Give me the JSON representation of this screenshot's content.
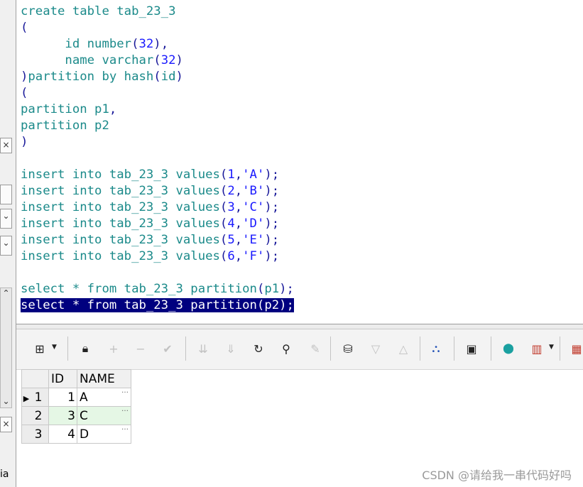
{
  "editor": {
    "lines": [
      [
        {
          "t": "create table tab_23_3",
          "c": "kw"
        }
      ],
      [
        {
          "t": "(",
          "c": "pn"
        }
      ],
      [
        {
          "t": "      id ",
          "c": "kw"
        },
        {
          "t": "number",
          "c": "kw"
        },
        {
          "t": "(",
          "c": "pn"
        },
        {
          "t": "32",
          "c": "nm"
        },
        {
          "t": "),",
          "c": "pn"
        }
      ],
      [
        {
          "t": "      name ",
          "c": "kw"
        },
        {
          "t": "varchar",
          "c": "kw"
        },
        {
          "t": "(",
          "c": "pn"
        },
        {
          "t": "32",
          "c": "nm"
        },
        {
          "t": ")",
          "c": "pn"
        }
      ],
      [
        {
          "t": ")",
          "c": "pn"
        },
        {
          "t": "partition by hash",
          "c": "kw"
        },
        {
          "t": "(",
          "c": "pn"
        },
        {
          "t": "id",
          "c": "kw"
        },
        {
          "t": ")",
          "c": "pn"
        }
      ],
      [
        {
          "t": "(",
          "c": "pn"
        }
      ],
      [
        {
          "t": "partition p1",
          "c": "kw"
        },
        {
          "t": ",",
          "c": "pn"
        }
      ],
      [
        {
          "t": "partition p2",
          "c": "kw"
        }
      ],
      [
        {
          "t": ")",
          "c": "pn"
        }
      ],
      [
        {
          "t": "",
          "c": "kw"
        }
      ],
      [
        {
          "t": "insert into tab_23_3 values",
          "c": "kw"
        },
        {
          "t": "(",
          "c": "pn"
        },
        {
          "t": "1",
          "c": "nm"
        },
        {
          "t": ",",
          "c": "pn"
        },
        {
          "t": "'A'",
          "c": "st"
        },
        {
          "t": ");",
          "c": "pn"
        }
      ],
      [
        {
          "t": "insert into tab_23_3 values",
          "c": "kw"
        },
        {
          "t": "(",
          "c": "pn"
        },
        {
          "t": "2",
          "c": "nm"
        },
        {
          "t": ",",
          "c": "pn"
        },
        {
          "t": "'B'",
          "c": "st"
        },
        {
          "t": ");",
          "c": "pn"
        }
      ],
      [
        {
          "t": "insert into tab_23_3 values",
          "c": "kw"
        },
        {
          "t": "(",
          "c": "pn"
        },
        {
          "t": "3",
          "c": "nm"
        },
        {
          "t": ",",
          "c": "pn"
        },
        {
          "t": "'C'",
          "c": "st"
        },
        {
          "t": ");",
          "c": "pn"
        }
      ],
      [
        {
          "t": "insert into tab_23_3 values",
          "c": "kw"
        },
        {
          "t": "(",
          "c": "pn"
        },
        {
          "t": "4",
          "c": "nm"
        },
        {
          "t": ",",
          "c": "pn"
        },
        {
          "t": "'D'",
          "c": "st"
        },
        {
          "t": ");",
          "c": "pn"
        }
      ],
      [
        {
          "t": "insert into tab_23_3 values",
          "c": "kw"
        },
        {
          "t": "(",
          "c": "pn"
        },
        {
          "t": "5",
          "c": "nm"
        },
        {
          "t": ",",
          "c": "pn"
        },
        {
          "t": "'E'",
          "c": "st"
        },
        {
          "t": ");",
          "c": "pn"
        }
      ],
      [
        {
          "t": "insert into tab_23_3 values",
          "c": "kw"
        },
        {
          "t": "(",
          "c": "pn"
        },
        {
          "t": "6",
          "c": "nm"
        },
        {
          "t": ",",
          "c": "pn"
        },
        {
          "t": "'F'",
          "c": "st"
        },
        {
          "t": ");",
          "c": "pn"
        }
      ],
      [
        {
          "t": "",
          "c": "kw"
        }
      ],
      [
        {
          "t": "select * from tab_23_3 partition",
          "c": "kw"
        },
        {
          "t": "(",
          "c": "pn"
        },
        {
          "t": "p1",
          "c": "kw"
        },
        {
          "t": ");",
          "c": "pn"
        }
      ],
      [
        {
          "t": "select * from tab_23_3 partition(p2);",
          "c": "hl"
        }
      ]
    ]
  },
  "toolbar": {
    "icons": [
      {
        "name": "grid-layout-icon",
        "glyph": "⊞",
        "enabled": true
      },
      {
        "name": "lock-icon",
        "glyph": "🔒︎",
        "enabled": true
      },
      {
        "name": "add-record-icon",
        "glyph": "+",
        "enabled": false
      },
      {
        "name": "delete-record-icon",
        "glyph": "−",
        "enabled": false
      },
      {
        "name": "post-changes-icon",
        "glyph": "✔",
        "enabled": false
      },
      {
        "name": "fetch-next-page-icon",
        "glyph": "⇊",
        "enabled": false
      },
      {
        "name": "fetch-all-icon",
        "glyph": "⇓",
        "enabled": false
      },
      {
        "name": "refresh-icon",
        "glyph": "↻",
        "enabled": true
      },
      {
        "name": "find-icon",
        "glyph": "⚲",
        "enabled": true
      },
      {
        "name": "clear-icon",
        "glyph": "✎",
        "enabled": false
      },
      {
        "name": "query-by-example-icon",
        "glyph": "⛁",
        "enabled": true
      },
      {
        "name": "sort-descending-icon",
        "glyph": "▽",
        "enabled": false
      },
      {
        "name": "sort-ascending-icon",
        "glyph": "△",
        "enabled": false
      },
      {
        "name": "link-tree-icon",
        "glyph": "⛬",
        "enabled": true
      },
      {
        "name": "save-icon",
        "glyph": "▣",
        "enabled": true
      },
      {
        "name": "export-icon",
        "glyph": "⬤",
        "enabled": true
      },
      {
        "name": "chart-icon",
        "glyph": "▥",
        "enabled": true
      },
      {
        "name": "table-export-icon",
        "glyph": "▦",
        "enabled": true
      }
    ]
  },
  "grid": {
    "columns": [
      "ID",
      "NAME"
    ],
    "rows": [
      {
        "num": "1",
        "id": "1",
        "name": "A"
      },
      {
        "num": "2",
        "id": "3",
        "name": "C"
      },
      {
        "num": "3",
        "id": "4",
        "name": "D"
      }
    ],
    "ellipsis": "…"
  },
  "left_panel": {
    "x_label": "×",
    "chevron": "⌄",
    "chevron_up": "⌃",
    "bottom_text": "ia"
  },
  "watermark": "CSDN @请给我一串代码好吗"
}
